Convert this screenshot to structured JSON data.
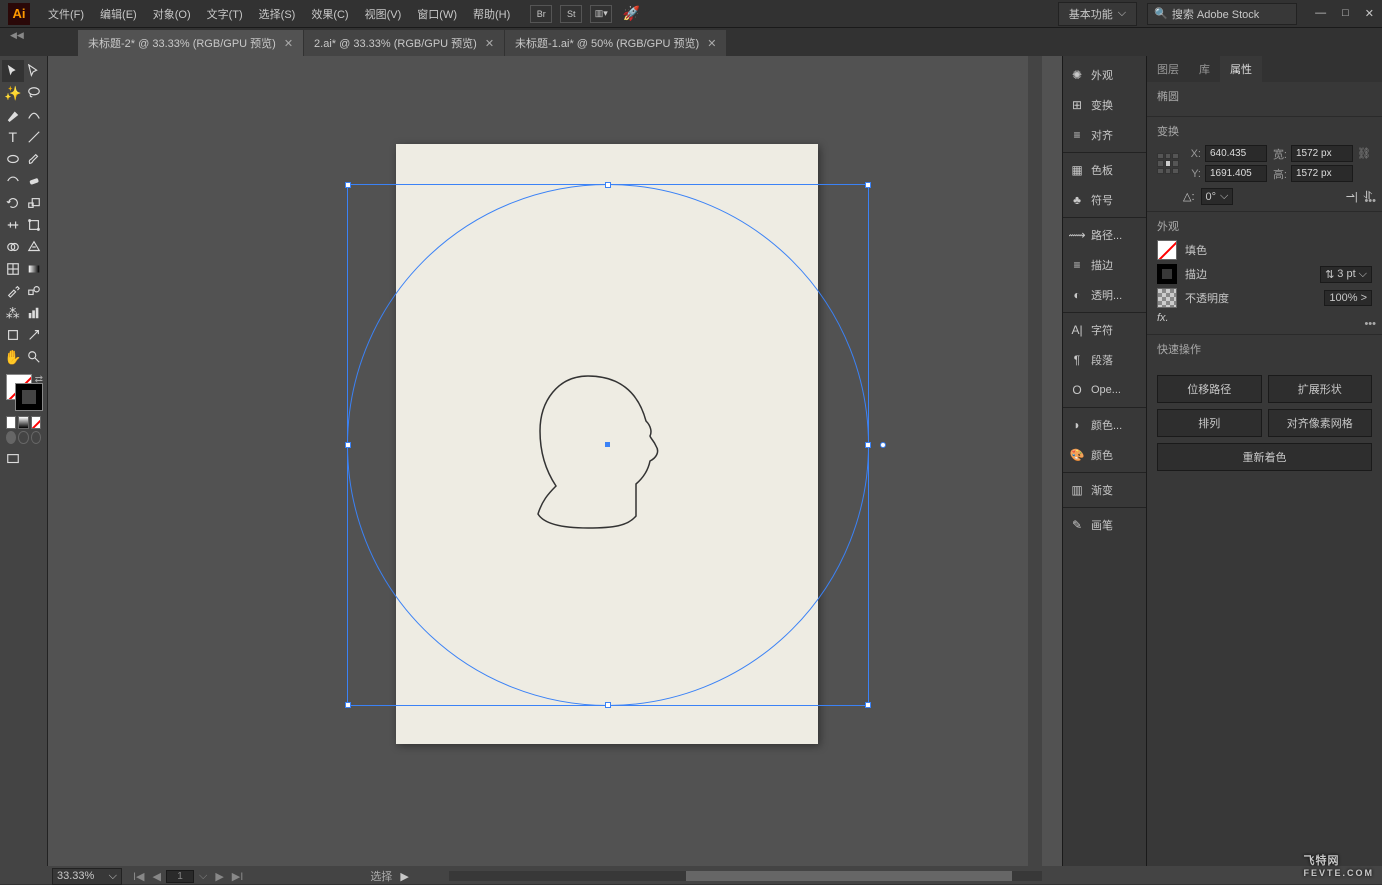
{
  "app": {
    "logo": "Ai"
  },
  "menu": [
    "文件(F)",
    "编辑(E)",
    "对象(O)",
    "文字(T)",
    "选择(S)",
    "效果(C)",
    "视图(V)",
    "窗口(W)",
    "帮助(H)"
  ],
  "menubar_icons": [
    "Br",
    "St"
  ],
  "workspace": {
    "label": "基本功能",
    "chevron": "⌵"
  },
  "search": {
    "placeholder": "搜索 Adobe Stock",
    "icon": "🔍"
  },
  "window_controls": {
    "min": "—",
    "max": "□",
    "close": "✕"
  },
  "tabs": [
    {
      "label": "未标题-2* @ 33.33% (RGB/GPU 预览)",
      "active": true
    },
    {
      "label": "2.ai* @ 33.33% (RGB/GPU 预览)",
      "active": false
    },
    {
      "label": "未标题-1.ai* @ 50% (RGB/GPU 预览)",
      "active": false
    }
  ],
  "zoom": "33.33%",
  "page_current": "1",
  "status": "选择",
  "dock": [
    {
      "icon": "✺",
      "label": "外观"
    },
    {
      "icon": "⊞",
      "label": "变换"
    },
    {
      "icon": "≡",
      "label": "对齐"
    },
    {
      "sep": true
    },
    {
      "icon": "▦",
      "label": "色板"
    },
    {
      "icon": "♣",
      "label": "符号"
    },
    {
      "sep": true
    },
    {
      "icon": "⟿",
      "label": "路径..."
    },
    {
      "icon": "≡",
      "label": "描边"
    },
    {
      "icon": "◐",
      "label": "透明..."
    },
    {
      "sep": true
    },
    {
      "icon": "A|",
      "label": "字符"
    },
    {
      "icon": "¶",
      "label": "段落"
    },
    {
      "icon": "O",
      "label": "Ope..."
    },
    {
      "sep": true
    },
    {
      "icon": "◗",
      "label": "颜色..."
    },
    {
      "icon": "🎨",
      "label": "颜色"
    },
    {
      "sep": true
    },
    {
      "icon": "▥",
      "label": "渐变"
    },
    {
      "sep": true
    },
    {
      "icon": "✎",
      "label": "画笔"
    }
  ],
  "panel_tabs": [
    "图层",
    "库",
    "属性"
  ],
  "selection_type": "椭圆",
  "sections": {
    "transform": "变换",
    "appearance": "外观",
    "quick": "快速操作"
  },
  "transform": {
    "x_label": "X:",
    "x": "640.435",
    "y_label": "Y:",
    "y": "1691.405",
    "w_label": "宽:",
    "w": "1572 px",
    "h_label": "高:",
    "h": "1572 px",
    "angle_label": "△:",
    "angle": "0°",
    "chevron": "⌵",
    "flip_h": "⇀|",
    "flip_v": "⥯"
  },
  "appearance": {
    "fill_label": "填色",
    "stroke_label": "描边",
    "stroke_val": "3 pt",
    "stroke_chev": "⌵",
    "opacity_label": "不透明度",
    "opacity_val": "100%",
    "opacity_chev": ">",
    "fx": "fx."
  },
  "actions": {
    "offset": "位移路径",
    "expand": "扩展形状",
    "arrange": "排列",
    "align_pixel": "对齐像素网格",
    "recolor": "重新着色"
  },
  "watermark": {
    "main": "飞特网",
    "sub": "FEVTE.COM"
  },
  "more": "•••"
}
